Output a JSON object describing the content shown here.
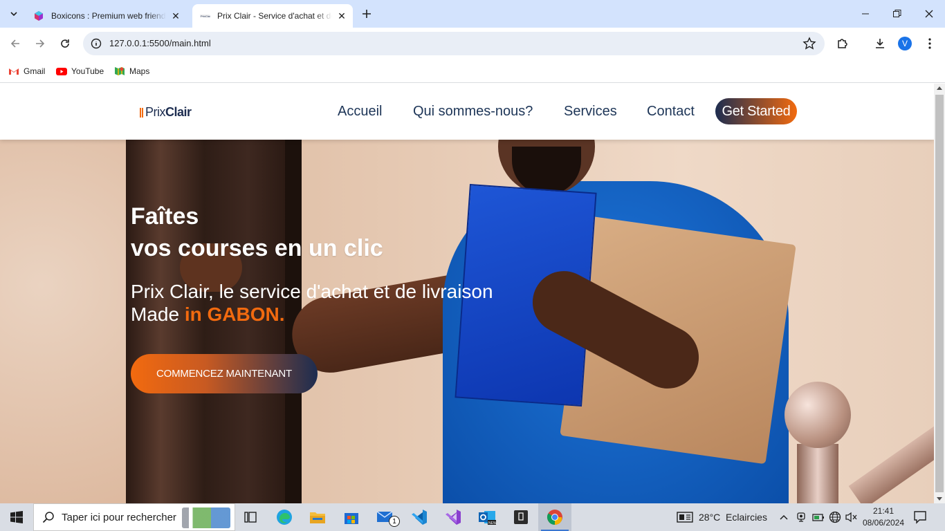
{
  "browser": {
    "tabs": [
      {
        "title": "Boxicons : Premium web friendly",
        "active": false,
        "favicon": "boxicons-icon"
      },
      {
        "title": "Prix Clair - Service d'achat et de",
        "active": true,
        "favicon": "prixclair-favicon"
      }
    ],
    "url": "127.0.0.1:5500/main.html",
    "avatar_letter": "V",
    "bookmarks": [
      {
        "label": "Gmail",
        "icon": "gmail-icon"
      },
      {
        "label": "YouTube",
        "icon": "youtube-icon"
      },
      {
        "label": "Maps",
        "icon": "maps-icon"
      }
    ]
  },
  "site": {
    "logo": {
      "part1": "Prix",
      "part2": "Clair"
    },
    "nav": [
      "Accueil",
      "Qui sommes-nous?",
      "Services",
      "Contact"
    ],
    "cta": "Get Started",
    "hero": {
      "title_line1": "Faîtes",
      "title_line2": "vos courses en un clic",
      "subtitle_line1": "Prix Clair, le service d'achat et de livraison",
      "subtitle_made": "Made ",
      "subtitle_highlight": "in GABON.",
      "button": "COMMENCEZ MAINTENANT"
    },
    "colors": {
      "accent": "#f26a0f",
      "navy": "#1d2d50"
    }
  },
  "taskbar": {
    "search_placeholder": "Taper ici pour rechercher",
    "weather": "28°C  Eclaircies",
    "time": "21:41",
    "date": "08/06/2024",
    "mail_badge": "1",
    "apps": [
      "task-view-icon",
      "edge-icon",
      "file-explorer-icon",
      "store-icon",
      "mail-icon",
      "vscode-icon",
      "visual-studio-icon",
      "outlook-icon",
      "terminal-icon",
      "chrome-icon"
    ]
  }
}
